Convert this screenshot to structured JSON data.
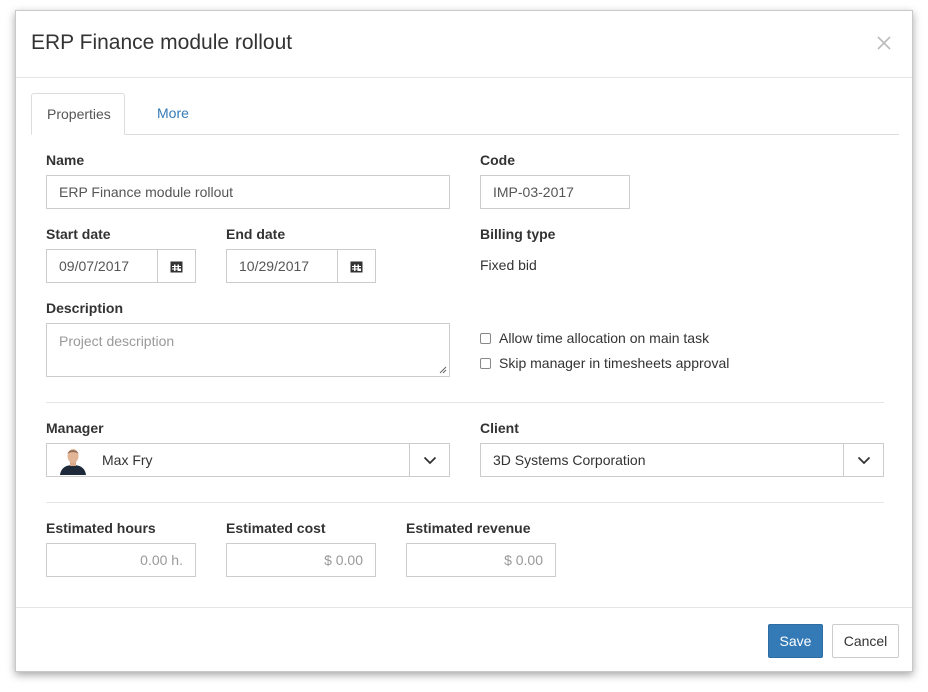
{
  "modal": {
    "title": "ERP Finance module rollout"
  },
  "tabs": [
    {
      "label": "Properties",
      "active": true
    },
    {
      "label": "More",
      "active": false
    }
  ],
  "fields": {
    "name": {
      "label": "Name",
      "value": "ERP Finance module rollout"
    },
    "code": {
      "label": "Code",
      "value": "IMP-03-2017"
    },
    "start_date": {
      "label": "Start date",
      "value": "09/07/2017"
    },
    "end_date": {
      "label": "End date",
      "value": "10/29/2017"
    },
    "billing_type": {
      "label": "Billing type",
      "value": "Fixed bid"
    },
    "description": {
      "label": "Description",
      "placeholder": "Project description",
      "value": ""
    },
    "manager": {
      "label": "Manager",
      "value": "Max Fry"
    },
    "client": {
      "label": "Client",
      "value": "3D Systems Corporation"
    },
    "estimated_hours": {
      "label": "Estimated hours",
      "value": "0.00 h."
    },
    "estimated_cost": {
      "label": "Estimated cost",
      "value": "$ 0.00"
    },
    "estimated_revenue": {
      "label": "Estimated revenue",
      "value": "$ 0.00"
    }
  },
  "options": {
    "allow_time_allocation": {
      "label": "Allow time allocation on main task",
      "checked": false
    },
    "skip_manager": {
      "label": "Skip manager in timesheets approval",
      "checked": false
    }
  },
  "footer": {
    "save_label": "Save",
    "cancel_label": "Cancel"
  },
  "colors": {
    "primary": "#337ab7",
    "link": "#337ab7",
    "border": "#cccccc"
  }
}
